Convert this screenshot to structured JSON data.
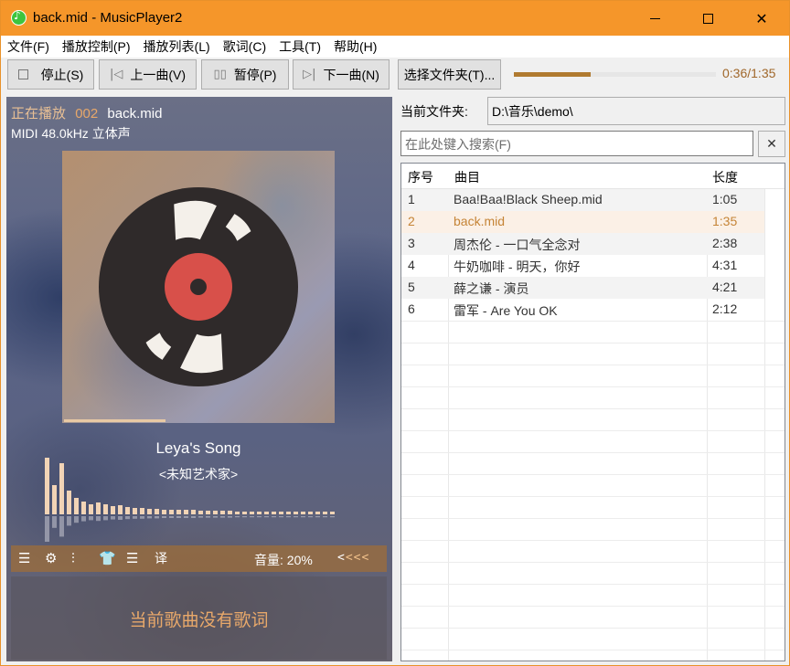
{
  "window": {
    "title": "back.mid - MusicPlayer2"
  },
  "menu": [
    "文件(F)",
    "播放控制(P)",
    "播放列表(L)",
    "歌词(C)",
    "工具(T)",
    "帮助(H)"
  ],
  "toolbar": {
    "stop_label": "停止(S)",
    "prev_label": "上一曲(V)",
    "pause_label": "暂停(P)",
    "next_label": "下一曲(N)",
    "folder_label": "选择文件夹(T)...",
    "progress": 0.3789,
    "time": "0:36/1:35"
  },
  "now_playing": {
    "label": "正在播放",
    "index": "002",
    "file": "back.mid",
    "format": "MIDI 48.0kHz 立体声",
    "song_title": "Leya's Song",
    "artist": "<未知艺术家>",
    "album_progress": 0.3789
  },
  "controls": {
    "icons": [
      "playlist-icon",
      "settings-icon",
      "equalizer-icon",
      "skin-icon",
      "menu-icon",
      "translate-icon"
    ],
    "translate_glyph": "译",
    "volume": "音量: 20%",
    "arrows_white": "<",
    "arrows_accent": "<<<"
  },
  "lyrics": {
    "empty_message": "当前歌曲没有歌词"
  },
  "folder": {
    "label": "当前文件夹:",
    "path": "D:\\音乐\\demo\\"
  },
  "search": {
    "placeholder": "在此处键入搜索(F)"
  },
  "playlist": {
    "columns": [
      "序号",
      "曲目",
      "长度"
    ],
    "rows": [
      {
        "no": "1",
        "title": "Baa!Baa!Black Sheep.mid",
        "length": "1:05"
      },
      {
        "no": "2",
        "title": "back.mid",
        "length": "1:35",
        "current": true
      },
      {
        "no": "3",
        "title": "周杰伦 - 一口气全念对",
        "length": "2:38"
      },
      {
        "no": "4",
        "title": "牛奶咖啡 - 明天，你好",
        "length": "4:31"
      },
      {
        "no": "5",
        "title": "薛之谦 - 演员",
        "length": "4:21"
      },
      {
        "no": "6",
        "title": "雷军 - Are You OK",
        "length": "2:12"
      }
    ]
  },
  "spectrum": [
    70,
    32,
    56,
    26,
    18,
    14,
    11,
    13,
    11,
    9,
    10,
    8,
    7,
    7,
    6,
    6,
    5,
    5,
    5,
    5,
    5,
    4,
    4,
    4,
    4,
    4,
    3,
    3,
    3,
    3,
    3,
    3,
    3,
    3,
    3,
    3,
    3,
    3,
    3,
    3
  ],
  "colors": {
    "titlebar": "#f5962a",
    "accent": "#c58436",
    "progress": "#b07a30"
  }
}
